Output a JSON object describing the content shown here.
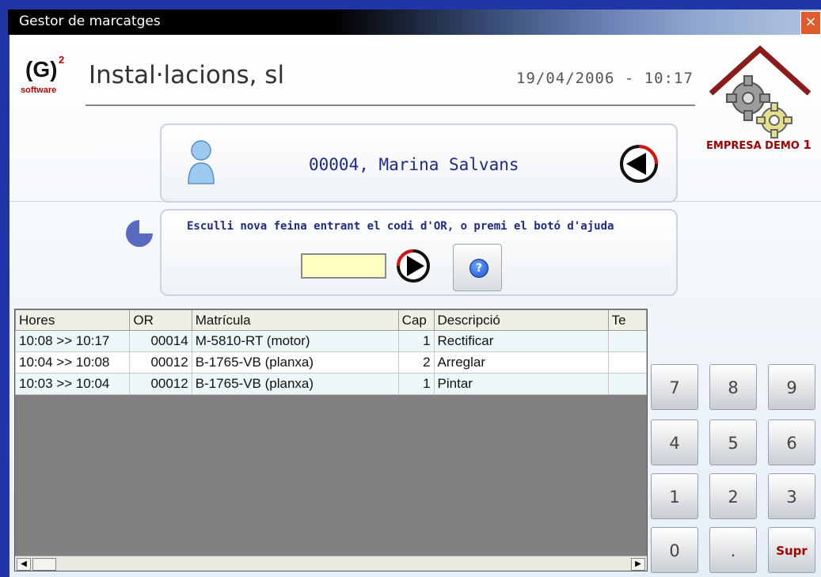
{
  "window": {
    "title": "Gestor de marcatges",
    "close_label": "×"
  },
  "header": {
    "logo_g": "(G)",
    "logo_sup": "2",
    "logo_soft": "software",
    "company": "Instal·lacions, sl",
    "datetime": "19/04/2006  -  10:17",
    "brand_label": "EMPRESA DEMO",
    "brand_number": "1"
  },
  "user": {
    "name": "00004, Marina Salvans"
  },
  "job": {
    "instruction": "Esculli nova feina entrant el codi d'OR, o premi el botó d'ajuda",
    "or_value": "",
    "help_label": "?"
  },
  "table": {
    "columns": [
      "Hores",
      "OR",
      "Matrícula",
      "Cap",
      "Descripció",
      "Te"
    ],
    "rows": [
      {
        "hores": "10:08 >> 10:17",
        "or": "00014",
        "matricula": "M-5810-RT (motor)",
        "cap": "1",
        "descripcio": "Rectificar",
        "te": ""
      },
      {
        "hores": "10:04 >> 10:08",
        "or": "00012",
        "matricula": "B-1765-VB (planxa)",
        "cap": "2",
        "descripcio": "Arreglar",
        "te": ""
      },
      {
        "hores": "10:03 >> 10:04",
        "or": "00012",
        "matricula": "B-1765-VB (planxa)",
        "cap": "1",
        "descripcio": "Pintar",
        "te": ""
      }
    ]
  },
  "keypad": {
    "k7": "7",
    "k8": "8",
    "k9": "9",
    "k4": "4",
    "k5": "5",
    "k6": "6",
    "k1": "1",
    "k2": "2",
    "k3": "3",
    "k0": "0",
    "kdot": ".",
    "ksupr": "Supr"
  },
  "colors": {
    "title_bg": "#000000",
    "frame": "#1f35a8",
    "accent_red": "#a30000",
    "text_blue": "#1f2a88",
    "input_bg": "#ffffc4"
  }
}
